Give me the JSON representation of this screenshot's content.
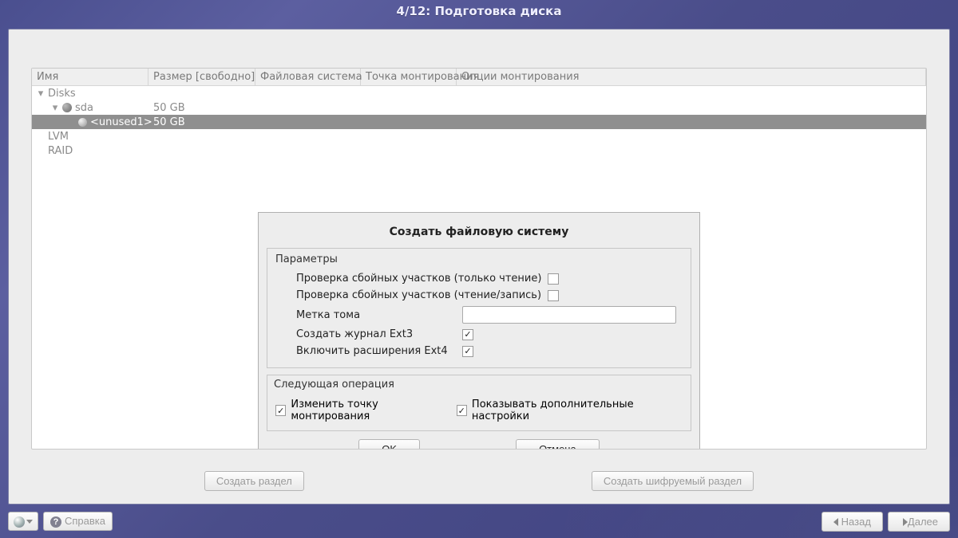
{
  "title": "4/12: Подготовка диска",
  "tree": {
    "headers": {
      "name": "Имя",
      "size": "Размер [свободно]",
      "fs": "Файловая система",
      "mount": "Точка монтирования",
      "opts": "Опции монтирования"
    },
    "root_disks": "Disks",
    "sda_name": "sda",
    "sda_size": "50 GB",
    "unused_name": "<unused1>",
    "unused_size": "50 GB",
    "lvm": "LVM",
    "raid": "RAID"
  },
  "bottom": {
    "create": "Создать раздел",
    "create_enc": "Создать шифруемый раздел"
  },
  "footer": {
    "help": "Справка",
    "back": "Назад",
    "next": "Далее"
  },
  "dialog": {
    "title": "Создать файловую систему",
    "params_legend": "Параметры",
    "opt_check_ro": "Проверка сбойных участков (только чтение)",
    "opt_check_rw": "Проверка сбойных участков (чтение/запись)",
    "opt_label": "Метка тома",
    "opt_ext3": "Создать журнал Ext3",
    "opt_ext4": "Включить расширения Ext4",
    "label_value": "",
    "check_ro": false,
    "check_rw": false,
    "ext3": true,
    "ext4": true,
    "nextop_legend": "Следующая операция",
    "nextop_mount": "Изменить точку монтирования",
    "nextop_adv": "Показывать дополнительные настройки",
    "nextop_mount_on": true,
    "nextop_adv_on": true,
    "ok": "OK",
    "cancel": "Отмена"
  }
}
